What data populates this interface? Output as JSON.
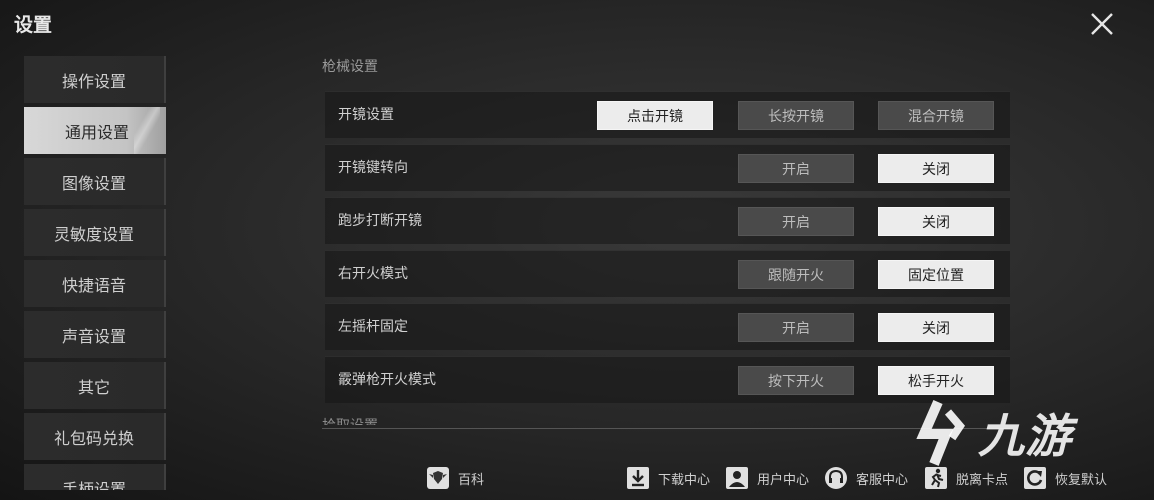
{
  "window": {
    "title": "设置"
  },
  "sidebar": {
    "items": [
      {
        "label": "操作设置",
        "active": false
      },
      {
        "label": "通用设置",
        "active": true
      },
      {
        "label": "图像设置",
        "active": false
      },
      {
        "label": "灵敏度设置",
        "active": false
      },
      {
        "label": "快捷语音",
        "active": false
      },
      {
        "label": "声音设置",
        "active": false
      },
      {
        "label": "其它",
        "active": false
      },
      {
        "label": "礼包码兑换",
        "active": false
      },
      {
        "label": "手柄设置",
        "active": false
      }
    ]
  },
  "main": {
    "section_title": "枪械设置",
    "next_section_title": "拾取设置",
    "rows": [
      {
        "label": "开镜设置",
        "options": [
          "点击开镜",
          "长按开镜",
          "混合开镜"
        ],
        "selected": "点击开镜"
      },
      {
        "label": "开镜键转向",
        "options": [
          "开启",
          "关闭"
        ],
        "selected": "关闭"
      },
      {
        "label": "跑步打断开镜",
        "options": [
          "开启",
          "关闭"
        ],
        "selected": "关闭"
      },
      {
        "label": "右开火模式",
        "options": [
          "跟随开火",
          "固定位置"
        ],
        "selected": "固定位置"
      },
      {
        "label": "左摇杆固定",
        "options": [
          "开启",
          "关闭"
        ],
        "selected": "关闭"
      },
      {
        "label": "霰弹枪开火模式",
        "options": [
          "按下开火",
          "松手开火"
        ],
        "selected": "松手开火"
      }
    ]
  },
  "footer": {
    "wiki": {
      "label": "百科",
      "icon": "shield-wings-icon"
    },
    "download": {
      "label": "下载中心",
      "icon": "download-icon"
    },
    "user": {
      "label": "用户中心",
      "icon": "user-icon"
    },
    "service": {
      "label": "客服中心",
      "icon": "headset-icon"
    },
    "unstuck": {
      "label": "脱离卡点",
      "icon": "running-man-icon"
    },
    "reset": {
      "label": "恢复默认",
      "icon": "refresh-icon"
    }
  },
  "watermark": {
    "text": "九游",
    "icon": "nine-game-logo-icon"
  },
  "colors": {
    "selected_bg": "#ececec",
    "unselected_bg": "#4a4a4a",
    "sidebar_active": "#d8d8d8"
  }
}
